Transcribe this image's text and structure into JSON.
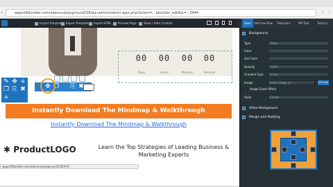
{
  "browser": {
    "url": "wpprofitbuilder.com/adenvu/playground258/wp-admin/admin-ajax.php?action=...pbuilder_edit&p=...5944"
  },
  "toolbar": {
    "items": [
      "Import Template",
      "Export Template",
      "Export HTML",
      "Preview Page",
      "Show / Hide Controls"
    ],
    "icons": [
      "upload-icon",
      "download-icon",
      "code-icon",
      "eye-icon",
      "toggle-icon"
    ]
  },
  "right_tabs": [
    "Save",
    "Add new Row",
    "Revisions",
    "WP Tool",
    "Tutorial"
  ],
  "page": {
    "countdown": [
      {
        "value": "00",
        "label": "Days"
      },
      {
        "value": "00",
        "label": "Hours"
      },
      {
        "value": "00",
        "label": "Minutes"
      },
      {
        "value": "00",
        "label": "Seconds"
      }
    ],
    "cta_button": "Instantly Download The Mindmap & Walkthrough",
    "cta_link": "Instantly Download The Mindmap & Walkthrough",
    "logo_text": "ProductLOGO",
    "tagline": "Learn the Top Strategies of Leading Business & Marketing Experts",
    "status_url": "wpprofitbuilder.com/adenvu/playground258/#/#"
  },
  "panel": {
    "background_section": "Background",
    "fields": [
      {
        "label": "Type",
        "value": "Static"
      },
      {
        "label": "Color",
        "value": ""
      },
      {
        "label": "2nd Color",
        "value": ""
      },
      {
        "label": "Opacity",
        "value": "100%"
      },
      {
        "label": "Gradient Type",
        "value": "Linear"
      },
      {
        "label": "Image",
        "value": "Enter image url"
      }
    ],
    "upload_label": "UPLOAD",
    "image_zoom_label": "Image Zoom Effect",
    "style_label": "Style",
    "style_value": "Center",
    "video_section": "Video Background",
    "margin_section": "Margin and Padding"
  },
  "colors": {
    "accent_blue": "#1e73be",
    "cta_orange": "#f37c22",
    "panel_bg": "#263238"
  }
}
